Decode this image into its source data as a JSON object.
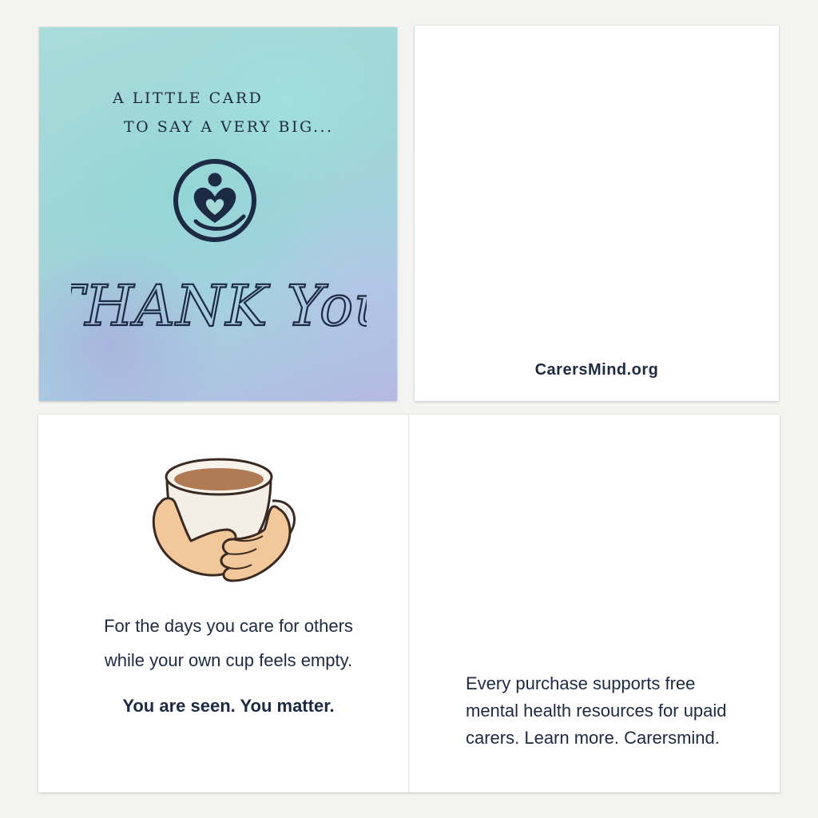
{
  "front_cover": {
    "tagline_line1": "A LITTLE CARD",
    "tagline_line2": "TO SAY A VERY BIG...",
    "headline": "THANK You",
    "logo_icon": "caring-hands-heart-logo",
    "background_colors": [
      "#a9dcdb",
      "#b5b8e2"
    ]
  },
  "back_cover": {
    "website": "CarersMind.org"
  },
  "inside_left": {
    "illustration": "hands-holding-tea-cup",
    "message_line1": "For the days you care for others",
    "message_line2": "while your own cup feels empty.",
    "affirmation": "You are seen. You matter."
  },
  "inside_right": {
    "promo_line1": "Every purchase supports free",
    "promo_line2": "mental health resources for upaid",
    "promo_line3": "carers. Learn more. Carersmind."
  },
  "colors": {
    "ink": "#1d2a44",
    "skin": "#f2c79a",
    "tea": "#b07a55"
  }
}
